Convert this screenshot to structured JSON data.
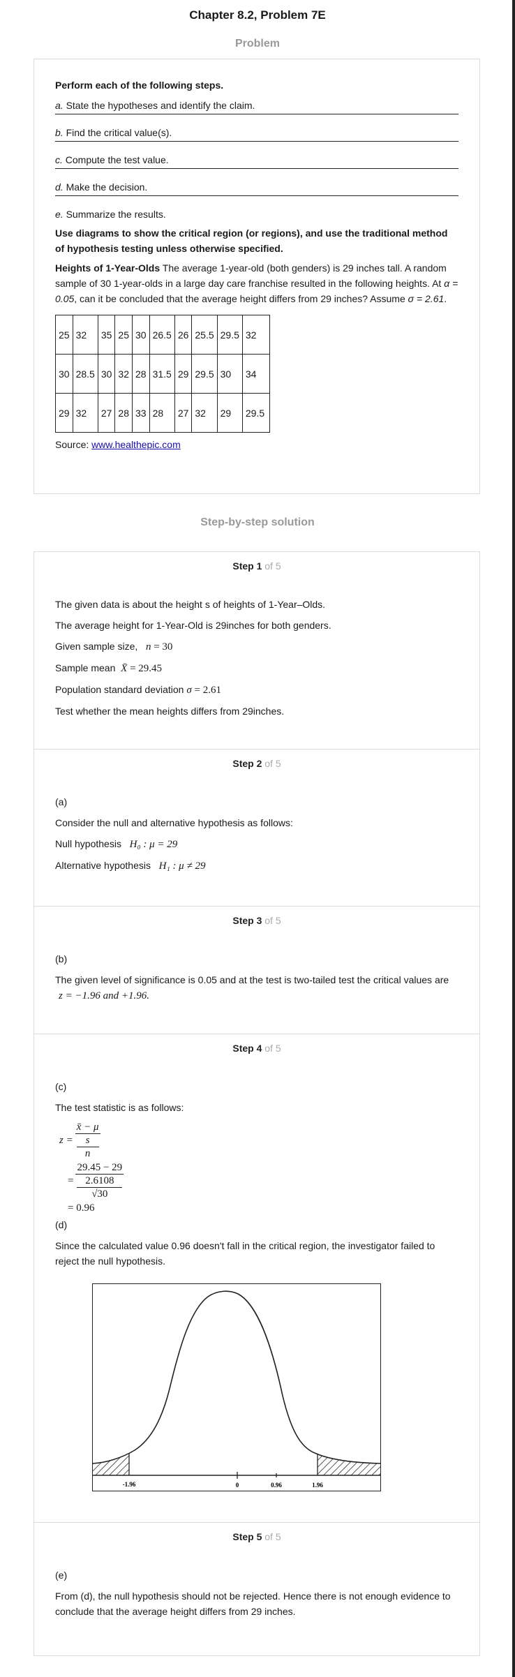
{
  "page_title": "Chapter 8.2, Problem 7E",
  "problem_heading": "Problem",
  "problem": {
    "instruction": "Perform each of the following steps.",
    "steps": [
      {
        "letter": "a.",
        "text": " State the hypotheses and identify the claim."
      },
      {
        "letter": "b.",
        "text": " Find the critical value(s)."
      },
      {
        "letter": "c.",
        "text": " Compute the test value."
      },
      {
        "letter": "d.",
        "text": " Make the decision."
      },
      {
        "letter": "e.",
        "text": " Summarize the results."
      }
    ],
    "diagram_note": "Use diagrams to show the critical region (or regions), and use the traditional method of hypothesis testing unless otherwise specified.",
    "heading": "Heights of 1-Year-Olds",
    "text_1": " The average 1-year-old (both genders) is 29 inches tall. A random sample of 30 1-year-olds in a large day care franchise resulted in the following heights. At ",
    "alpha": "α = 0.05",
    "text_2": ", can it be concluded that the average height differs from 29 inches? Assume ",
    "sigma": "σ = 2.61",
    "text_3": ".",
    "table": [
      [
        "25",
        "32",
        "35",
        "25",
        "30",
        "26.5",
        "26",
        "25.5",
        "29.5",
        "32"
      ],
      [
        "30",
        "28.5",
        "30",
        "32",
        "28",
        "31.5",
        "29",
        "29.5",
        "30",
        "34"
      ],
      [
        "29",
        "32",
        "27",
        "28",
        "33",
        "28",
        "27",
        "32",
        "29",
        "29.5"
      ]
    ],
    "source_label": "Source: ",
    "source_link": "www.healthepic.com"
  },
  "solution_heading": "Step-by-step solution",
  "steps": [
    {
      "num": "Step 1",
      "of": " of 5",
      "lines": {
        "l1": "The given data is about the height s of heights of 1-Year–Olds.",
        "l2": "The average height for 1-Year-Old is 29inches for both genders.",
        "l3_label": "Given sample size,",
        "l3_math_var": "n",
        "l3_math_val": " = 30",
        "l4_label": "Sample mean",
        "l4_math_var": "X̄",
        "l4_math_val": " = 29.45",
        "l5_label": "Population standard deviation",
        "l5_math_var": "σ",
        "l5_math_val": " = 2.61",
        "l6": "Test whether the mean heights differs from 29inches."
      }
    },
    {
      "num": "Step 2",
      "of": " of 5",
      "part": "(a)",
      "intro": "Consider the null and alternative hypothesis as follows:",
      "null_label": "Null hypothesis",
      "null_math": "H₀ : μ = 29",
      "alt_label": "Alternative hypothesis",
      "alt_math": "H₁ : μ ≠ 29"
    },
    {
      "num": "Step 3",
      "of": " of 5",
      "part": "(b)",
      "text": "The given level of significance is 0.05 and at the test is two-tailed test the critical values are",
      "math": "z = −1.96 and +1.96."
    },
    {
      "num": "Step 4",
      "of": " of 5",
      "part_c": "(c)",
      "intro": "The test statistic is as follows:",
      "eq_z": "z =",
      "eq_num1": "x̄ − μ",
      "eq_s": "s",
      "eq_n": "n",
      "eq_eq2": "=",
      "eq_num2": "29.45 − 29",
      "eq_den2": "2.6108",
      "eq_den3": "√30",
      "eq_result": "= 0.96",
      "part_d": "(d)",
      "decision": "Since the calculated value 0.96 doesn't fall in the critical region, the investigator failed to reject the null hypothesis.",
      "plot_labels": {
        "left": "-1.96",
        "zero": "0",
        "stat": "0.96",
        "right": "1.96"
      }
    },
    {
      "num": "Step 5",
      "of": " of 5",
      "part": "(e)",
      "text": "From (d), the null hypothesis should not be rejected. Hence there is not enough evidence to conclude that the average height differs from 29 inches."
    }
  ]
}
